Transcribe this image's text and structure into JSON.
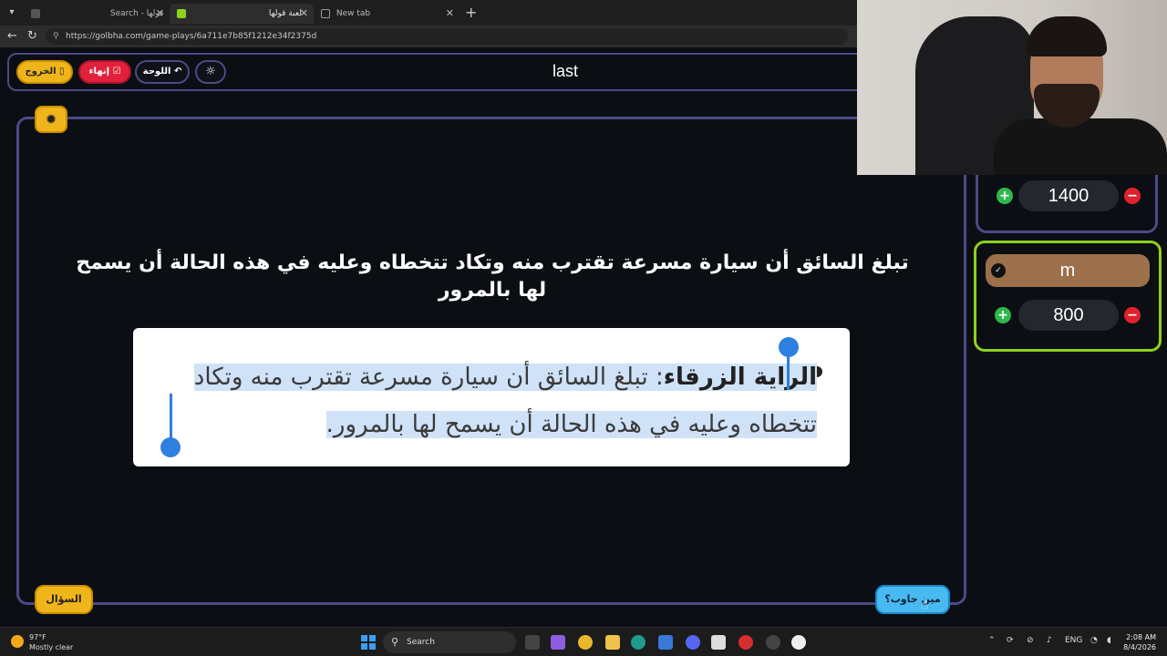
{
  "browser": {
    "tabs": [
      {
        "label": "Search - قولها",
        "active": false
      },
      {
        "label": "لعبة قولها",
        "active": true
      },
      {
        "label": "New tab",
        "active": false
      }
    ],
    "url": "https://golbha.com/game-plays/6a711e7b85f1212e34f2375d"
  },
  "header": {
    "exit_label": "الخروج",
    "end_label": "إنهاء",
    "board_label": "اللوحة",
    "theme_icon": "sun-icon",
    "title": "last"
  },
  "game": {
    "question": "تبلغ السائق أن سيارة مسرعة تقترب منه وتكاد تتخطاه وعليه في هذه الحالة أن يسمح لها بالمرور",
    "answer_term": "الراية الزرقاء",
    "answer_sep": ": ",
    "answer_body": "تبلغ السائق أن سيارة مسرعة تقترب منه وتكاد تتخطاه وعليه في هذه الحالة أن يسمح لها بالمرور.",
    "question_button": "السؤال",
    "who_answered_button": "مين جاوب؟"
  },
  "teams": [
    {
      "name": "",
      "score": "1400"
    },
    {
      "name": "m",
      "score": "800"
    }
  ],
  "colors": {
    "accent_purple": "#4b4a86",
    "gold": "#f0b51b",
    "red": "#e2213c",
    "green": "#8ed11d",
    "blue": "#49b9f2"
  },
  "taskbar": {
    "weather_temp": "97°F",
    "weather_desc": "Mostly clear",
    "search_label": "Search",
    "lang": "ENG",
    "time": "2:08 AM",
    "date": "8/4/2026"
  }
}
